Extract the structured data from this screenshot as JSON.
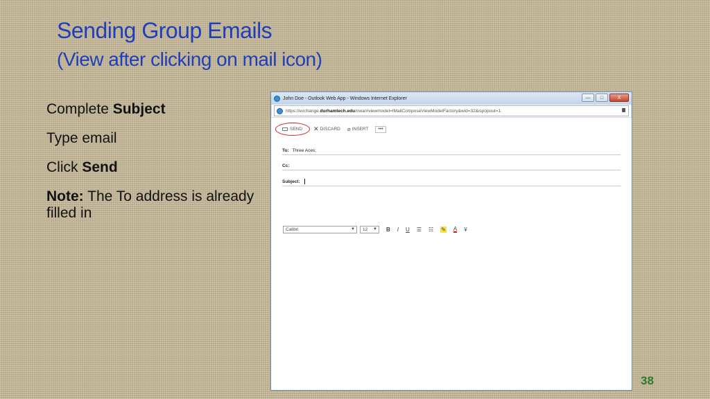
{
  "slide": {
    "title_line1": "Sending Group Emails",
    "title_line2": "(View after clicking on mail icon)",
    "bullets": {
      "b1_prefix": "Complete ",
      "b1_bold": "Subject",
      "b2": "Type email",
      "b3_prefix": "Click ",
      "b3_bold": "Send",
      "b4_bold": "Note:",
      "b4_rest": " The To address is already filled in"
    },
    "page_number": "38"
  },
  "window": {
    "title": "John Doe - Outlook Web App - Windows Internet Explorer",
    "address_prefix": "https://exchange.",
    "address_host": "durhamtech.edu",
    "address_rest": "/owa/#viewmodel=IMailComposeViewModelFactory&wid=32&ispopout=1",
    "buttons": {
      "minimize": "—",
      "maximize": "□",
      "close": "X"
    }
  },
  "compose": {
    "toolbar": {
      "send": "SEND",
      "discard": "DISCARD",
      "insert": "INSERT",
      "more": "•••"
    },
    "to_label": "To:",
    "to_value": "Three Aces;",
    "cc_label": "Cc:",
    "subject_label": "Subject:",
    "font_name": "Calibri",
    "font_size": "12",
    "format": {
      "bold": "B",
      "italic": "I",
      "underline": "U",
      "more": "¥"
    }
  },
  "colors": {
    "title": "#1f3fb8",
    "page_number": "#2c7a2c",
    "send_highlight_circle": "#d12222"
  }
}
